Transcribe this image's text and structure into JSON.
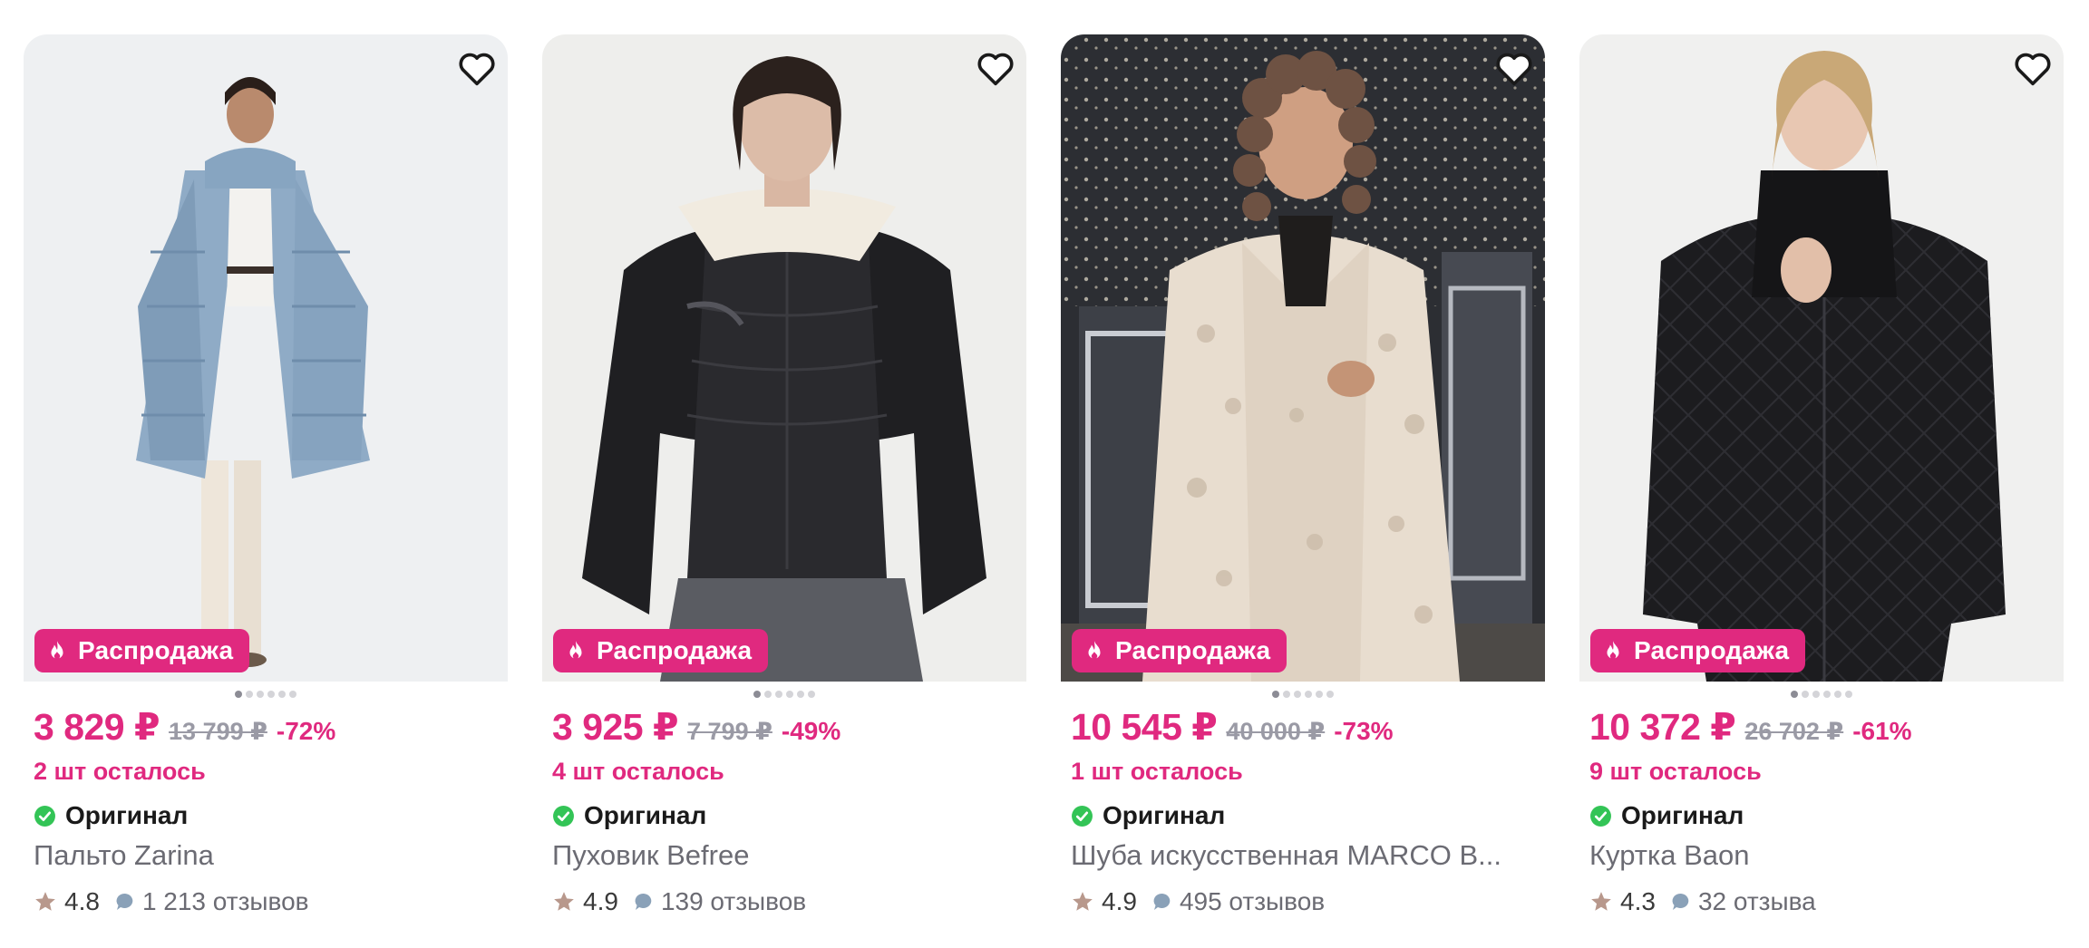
{
  "colors": {
    "accent": "#e0297f",
    "strike": "#9a9aa5",
    "check": "#33c456",
    "star": "#b8988c",
    "bubble": "#8aa1b8"
  },
  "products": [
    {
      "sale_label": "Распродажа",
      "price": "3 829 ₽",
      "old_price": "13 799 ₽",
      "discount": "-72%",
      "stock": "2 шт осталось",
      "original_label": "Оригинал",
      "name": "Пальто Zarina",
      "rating": "4.8",
      "reviews": "1 213 отзывов",
      "image_count": 6,
      "active_image": 1
    },
    {
      "sale_label": "Распродажа",
      "price": "3 925 ₽",
      "old_price": "7 799 ₽",
      "discount": "-49%",
      "stock": "4 шт осталось",
      "original_label": "Оригинал",
      "name": "Пуховик Befree",
      "rating": "4.9",
      "reviews": "139 отзывов",
      "image_count": 6,
      "active_image": 1
    },
    {
      "sale_label": "Распродажа",
      "price": "10 545 ₽",
      "old_price": "40 000 ₽",
      "discount": "-73%",
      "stock": "1 шт осталось",
      "original_label": "Оригинал",
      "name": "Шуба искусственная MARCO B...",
      "rating": "4.9",
      "reviews": "495 отзывов",
      "image_count": 6,
      "active_image": 1
    },
    {
      "sale_label": "Распродажа",
      "price": "10 372 ₽",
      "old_price": "26 702 ₽",
      "discount": "-61%",
      "stock": "9 шт осталось",
      "original_label": "Оригинал",
      "name": "Куртка Baon",
      "rating": "4.3",
      "reviews": "32 отзыва",
      "image_count": 6,
      "active_image": 1
    }
  ],
  "icons": {
    "favorite": "heart-outline-icon",
    "sale": "flame-icon",
    "original": "check-circle-icon",
    "rating": "star-icon",
    "reviews": "chat-bubble-icon"
  }
}
